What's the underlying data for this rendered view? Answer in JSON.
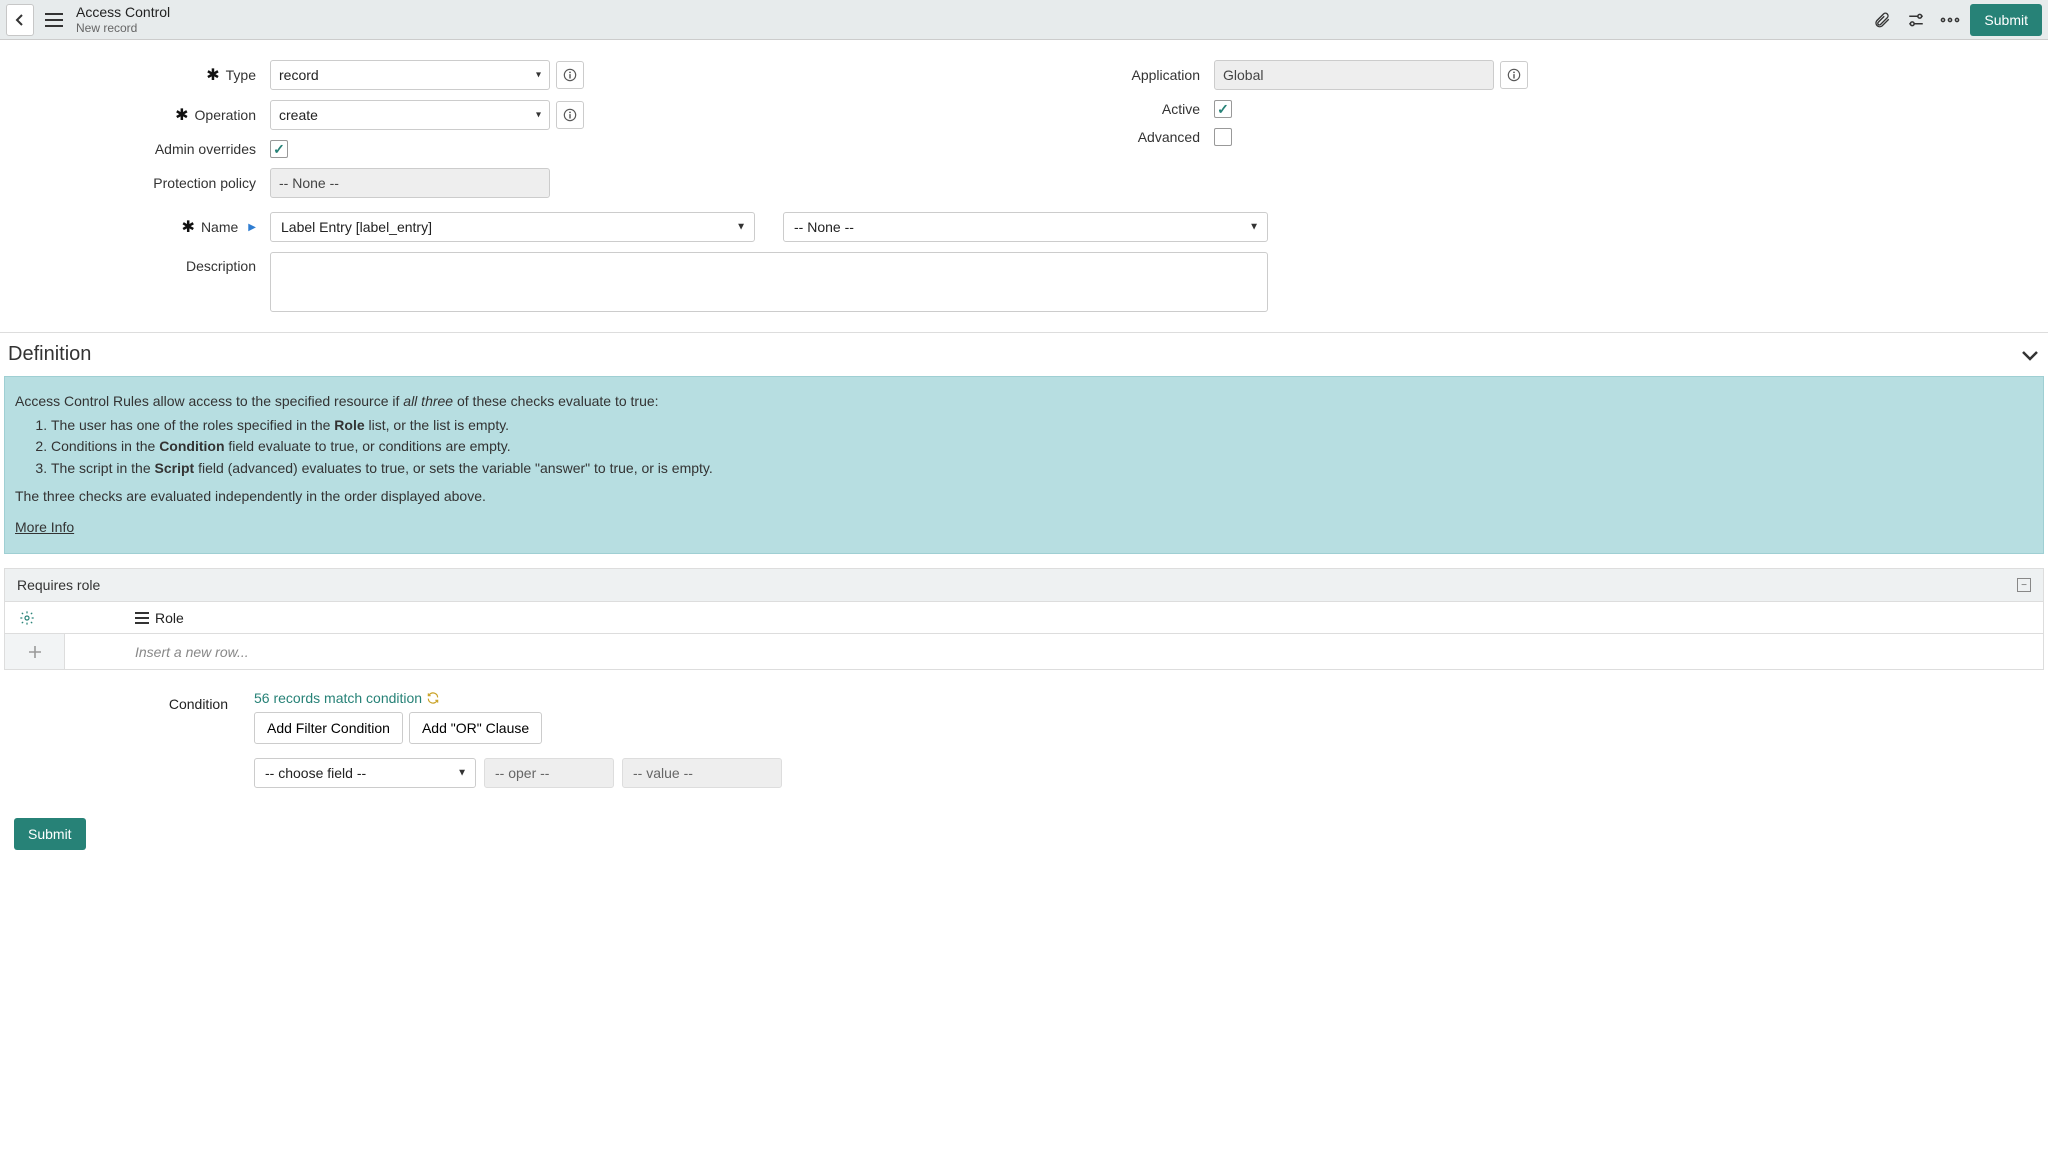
{
  "header": {
    "title": "Access Control",
    "subtitle": "New record",
    "submit": "Submit"
  },
  "form": {
    "labels": {
      "type": "Type",
      "operation": "Operation",
      "admin_overrides": "Admin overrides",
      "protection_policy": "Protection policy",
      "name": "Name",
      "description": "Description",
      "application": "Application",
      "active": "Active",
      "advanced": "Advanced"
    },
    "values": {
      "type": "record",
      "operation": "create",
      "admin_overrides": true,
      "protection_policy": "-- None --",
      "name_table": "Label Entry [label_entry]",
      "name_field": "-- None --",
      "application": "Global",
      "active": true,
      "advanced": false
    }
  },
  "section": {
    "definition": "Definition"
  },
  "banner": {
    "l1a": "Access Control Rules allow access to the specified resource if ",
    "l1b": "all three",
    "l1c": " of these checks evaluate to true:",
    "li1a": "The user has one of the roles specified in the ",
    "li1b": "Role",
    "li1c": " list, or the list is empty.",
    "li2a": "Conditions in the ",
    "li2b": "Condition",
    "li2c": " field evaluate to true, or conditions are empty.",
    "li3a": "The script in the ",
    "li3b": "Script",
    "li3c": " field (advanced) evaluates to true, or sets the variable \"answer\" to true, or is empty.",
    "l2": "The three checks are evaluated independently in the order displayed above.",
    "more": "More Info"
  },
  "roles": {
    "header": "Requires role",
    "col": "Role",
    "insert_placeholder": "Insert a new row..."
  },
  "condition": {
    "label": "Condition",
    "match_text": "56 records match condition",
    "add_filter": "Add Filter Condition",
    "add_or": "Add \"OR\" Clause",
    "choose_field": "-- choose field --",
    "oper": "-- oper --",
    "value": "-- value --"
  },
  "footer": {
    "submit": "Submit"
  }
}
